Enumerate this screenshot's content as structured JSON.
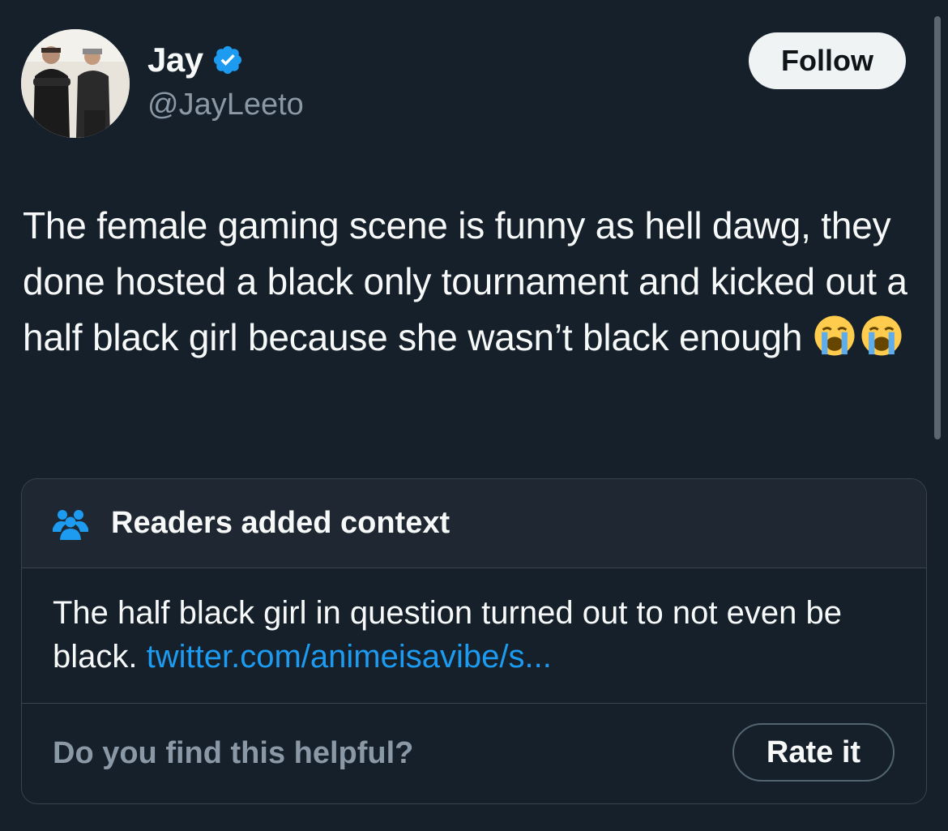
{
  "author": {
    "name": "Jay",
    "handle": "@JayLeeto",
    "verified": true,
    "avatar_icon": "avatar-photo-two-men"
  },
  "follow_label": "Follow",
  "tweet": {
    "text": "The female gaming scene is funny as hell dawg, they done hosted a black only tournament and kicked out a half black girl because she wasn’t black enough",
    "emojis": [
      "loudly-crying-face",
      "loudly-crying-face"
    ]
  },
  "community_note": {
    "title": "Readers added context",
    "icon": "people-icon",
    "body": "The half black girl in question turned out to not even be black.",
    "link": "twitter.com/animeisavibe/s...",
    "helpful_prompt": "Do you find this helpful?",
    "rate_label": "Rate it"
  },
  "colors": {
    "background": "#15202b",
    "accent": "#1d9bf0",
    "text": "#f7f9f9",
    "muted": "#8b98a5"
  }
}
